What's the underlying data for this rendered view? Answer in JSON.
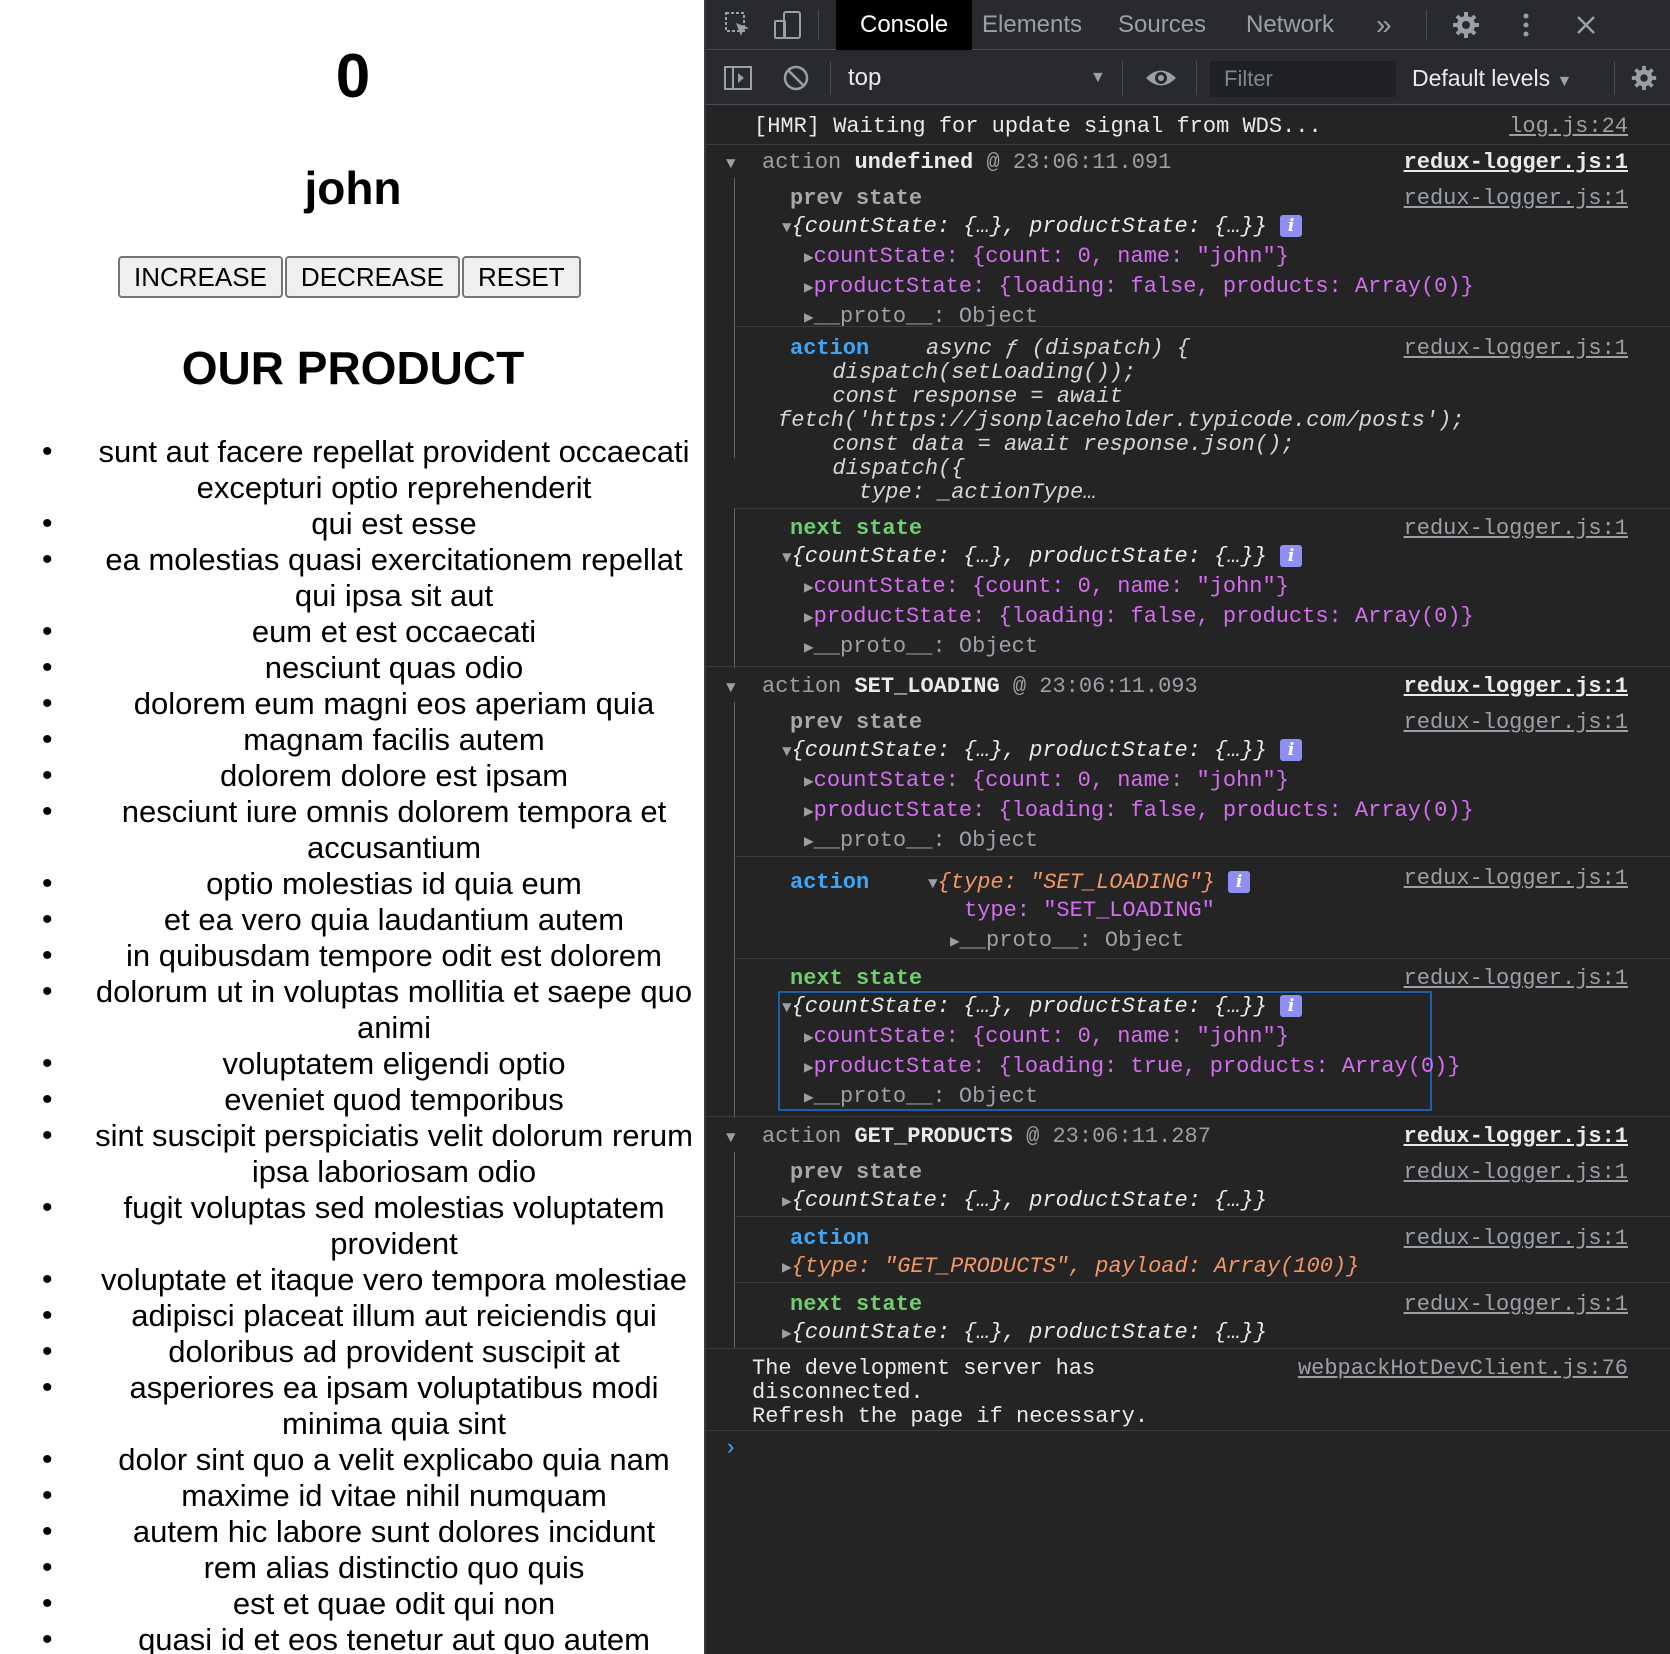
{
  "app": {
    "count": "0",
    "name": "john",
    "buttons": {
      "increase": "INCREASE",
      "decrease": "DECREASE",
      "reset": "RESET"
    },
    "products_title": "OUR PRODUCT",
    "products": [
      "sunt aut facere repellat provident occaecati excepturi optio reprehenderit",
      "qui est esse",
      "ea molestias quasi exercitationem repellat qui ipsa sit aut",
      "eum et est occaecati",
      "nesciunt quas odio",
      "dolorem eum magni eos aperiam quia",
      "magnam facilis autem",
      "dolorem dolore est ipsam",
      "nesciunt iure omnis dolorem tempora et accusantium",
      "optio molestias id quia eum",
      "et ea vero quia laudantium autem",
      "in quibusdam tempore odit est dolorem",
      "dolorum ut in voluptas mollitia et saepe quo animi",
      "voluptatem eligendi optio",
      "eveniet quod temporibus",
      "sint suscipit perspiciatis velit dolorum rerum ipsa laboriosam odio",
      "fugit voluptas sed molestias voluptatem provident",
      "voluptate et itaque vero tempora molestiae",
      "adipisci placeat illum aut reiciendis qui",
      "doloribus ad provident suscipit at",
      "asperiores ea ipsam voluptatibus modi minima quia sint",
      "dolor sint quo a velit explicabo quia nam",
      "maxime id vitae nihil numquam",
      "autem hic labore sunt dolores incidunt",
      "rem alias distinctio quo quis",
      "est et quae odit qui non",
      "quasi id et eos tenetur aut quo autem"
    ]
  },
  "devtools": {
    "tabs": [
      "Console",
      "Elements",
      "Sources",
      "Network"
    ],
    "active_tab": "Console",
    "more_tabs": "»",
    "context": "top",
    "filter_placeholder": "Filter",
    "levels": "Default levels",
    "icons": [
      "inspect-icon",
      "device-toolbar-icon",
      "gear-icon",
      "kebab-menu-icon",
      "close-icon",
      "sidebar-toggle-icon",
      "clear-console-icon",
      "eye-icon",
      "settings-icon"
    ]
  },
  "console": {
    "hmr": {
      "text": "[HMR] Waiting for update signal from WDS...",
      "source": "log.js:24"
    },
    "logger_source": "redux-logger.js:1",
    "obj_summary": "{countState: {…}, productState: {…}}",
    "count_state": "countState: {count: 0, name: \"john\"}",
    "product_state_false": "productState: {loading: false, products: Array(0)}",
    "product_state_true": "productState: {loading: true, products: Array(0)}",
    "proto": "__proto__: Object",
    "labels": {
      "action": "action",
      "prev_state": "prev state",
      "next_state": "next state"
    },
    "groups": [
      {
        "name": "undefined",
        "time": "@ 23:06:11.091"
      },
      {
        "name": "SET_LOADING",
        "time": "@ 23:06:11.093"
      },
      {
        "name": "GET_PRODUCTS",
        "time": "@ 23:06:11.287"
      }
    ],
    "async_fn": [
      "async ƒ (dispatch) {",
      "  dispatch(setLoading());",
      "  const response = await",
      "fetch('https://jsonplaceholder.typicode.com/posts');",
      "  const data = await response.json();",
      "  dispatch({",
      "    type: _actionType…"
    ],
    "set_loading_action": "{type: \"SET_LOADING\"}",
    "set_loading_type": "type: \"SET_LOADING\"",
    "get_products_action": "{type: \"GET_PRODUCTS\", payload: Array(100)}",
    "disconnect": [
      "The development server has",
      "disconnected.",
      "Refresh the page if necessary."
    ],
    "disconnect_source": "webpackHotDevClient.js:76",
    "prompt": "›"
  }
}
